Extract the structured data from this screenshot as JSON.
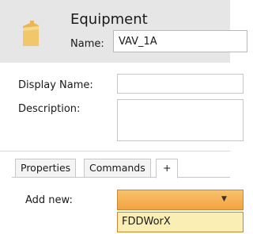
{
  "header": {
    "title": "Equipment",
    "name_label": "Name:",
    "name_value": "VAV_1A"
  },
  "form": {
    "display_name_label": "Display Name:",
    "display_name_value": "",
    "description_label": "Description:",
    "description_value": ""
  },
  "tabs": [
    {
      "label": "Properties"
    },
    {
      "label": "Commands"
    },
    {
      "label": "+"
    }
  ],
  "add_new": {
    "label": "Add new:",
    "selected": "",
    "options": [
      "FDDWorX"
    ]
  },
  "colors": {
    "header_bg": "#e6e6e6",
    "folder": "#f2c76b",
    "select_accent": "#f4a23f",
    "option_highlight": "#fbeeb5"
  },
  "icons": {
    "header": "folder-icon",
    "dropdown": "chevron-down-icon"
  }
}
